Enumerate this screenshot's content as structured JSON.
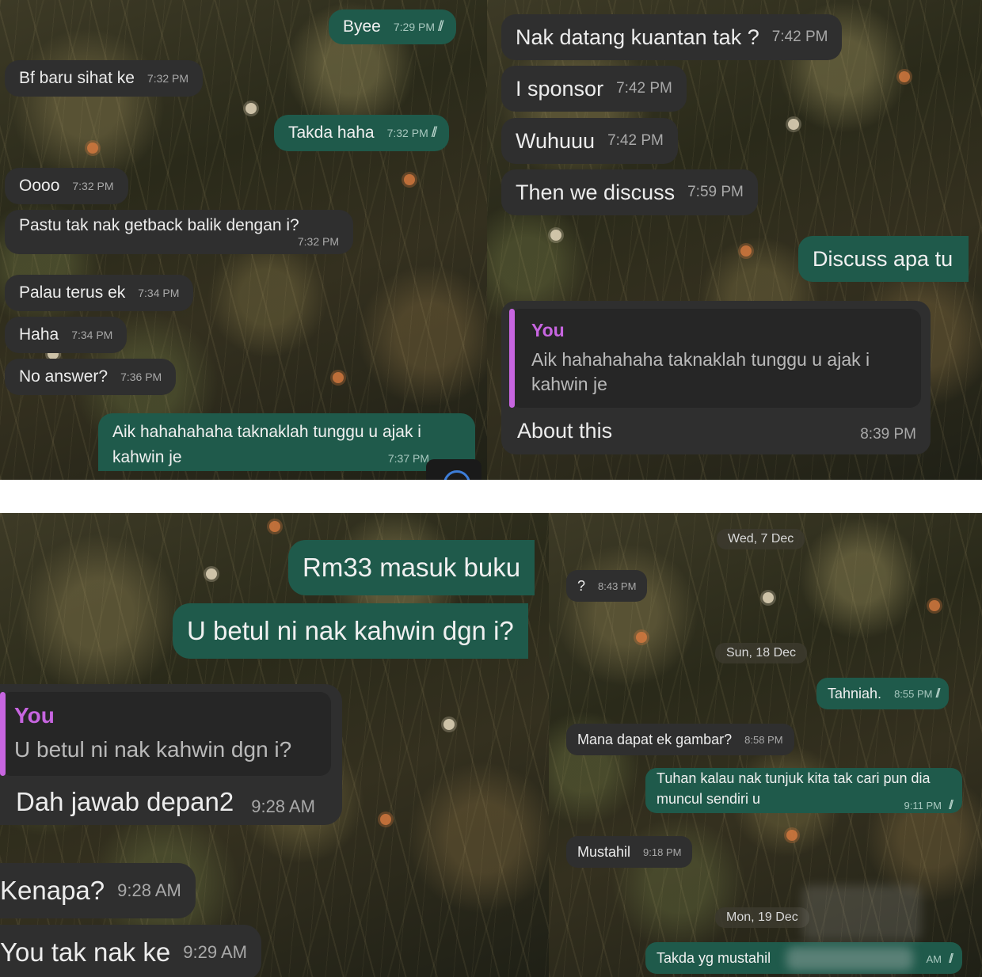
{
  "panel1": {
    "messages": [
      {
        "dir": "out",
        "text": "Byee",
        "time": "7:29 PM",
        "ticks": "//"
      },
      {
        "dir": "in",
        "text": "Bf baru sihat ke",
        "time": "7:32 PM"
      },
      {
        "dir": "out",
        "text": "Takda haha",
        "time": "7:32 PM",
        "ticks": "//"
      },
      {
        "dir": "in",
        "text": "Oooo",
        "time": "7:32 PM"
      },
      {
        "dir": "in",
        "text": "Pastu tak nak getback balik dengan i?",
        "time": "7:32 PM"
      },
      {
        "dir": "in",
        "text": "Palau terus ek",
        "time": "7:34 PM"
      },
      {
        "dir": "in",
        "text": "Haha",
        "time": "7:34 PM"
      },
      {
        "dir": "in",
        "text": "No answer?",
        "time": "7:36 PM"
      },
      {
        "dir": "out",
        "text": "Aik hahahahaha taknaklah tunggu u ajak i kahwin je",
        "time": "7:37 PM"
      }
    ]
  },
  "panel2": {
    "messages": [
      {
        "dir": "in",
        "text": "Nak datang kuantan tak ?",
        "time": "7:42 PM"
      },
      {
        "dir": "in",
        "text": "I sponsor",
        "time": "7:42 PM"
      },
      {
        "dir": "in",
        "text": "Wuhuuu",
        "time": "7:42 PM"
      },
      {
        "dir": "in",
        "text": "Then we discuss",
        "time": "7:59 PM"
      },
      {
        "dir": "out",
        "text": "Discuss apa tu"
      }
    ],
    "reply": {
      "name": "You",
      "quoted": "Aik hahahahaha taknaklah tunggu u ajak i kahwin je",
      "text": "About this",
      "time": "8:39 PM"
    }
  },
  "panel3": {
    "messages": [
      {
        "dir": "out",
        "text": "Rm33 masuk buku"
      },
      {
        "dir": "out",
        "text": "U betul ni nak kahwin dgn i?"
      }
    ],
    "reply": {
      "name": "You",
      "quoted": "U betul ni nak kahwin dgn i?",
      "text": "Dah jawab depan2",
      "time": "9:28 AM"
    },
    "after": [
      {
        "dir": "in",
        "text": "Kenapa?",
        "time": "9:28 AM"
      },
      {
        "dir": "in",
        "text": "You tak nak ke",
        "time": "9:29 AM"
      }
    ]
  },
  "panel4": {
    "dates": [
      "Wed, 7 Dec",
      "Sun, 18 Dec",
      "Mon, 19 Dec"
    ],
    "messages": [
      {
        "dir": "in",
        "text": "?",
        "time": "8:43 PM"
      },
      {
        "dir": "out",
        "text": "Tahniah.",
        "time": "8:55 PM",
        "ticks": "//"
      },
      {
        "dir": "in",
        "text": "Mana dapat ek gambar?",
        "time": "8:58 PM"
      },
      {
        "dir": "out",
        "text": "Tuhan kalau nak tunjuk kita tak cari pun dia muncul sendiri u",
        "time": "9:11 PM",
        "ticks": "//"
      },
      {
        "dir": "in",
        "text": "Mustahil",
        "time": "9:18 PM"
      },
      {
        "dir": "out",
        "text": "Takda yg mustahil",
        "time": "AM",
        "ticks": "//"
      }
    ]
  },
  "colors": {
    "incoming": "#2f2f2f",
    "outgoing": "#1f5a4b",
    "reply_accent": "#c765e0"
  }
}
